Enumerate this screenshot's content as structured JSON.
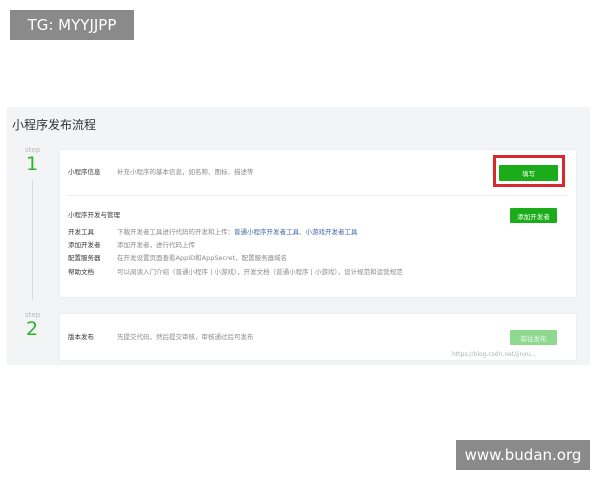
{
  "overlay": {
    "top_left_tag": "TG: MYYJJPP",
    "bottom_right_tag": "www.budan.org",
    "image_watermark": "https://blog.csdn.net/jinxu..."
  },
  "page": {
    "title": "小程序发布流程"
  },
  "steps": [
    {
      "label": "step",
      "number": "1",
      "rows": [
        {
          "label": "小程序信息",
          "desc": "补充小程序的基本信息，如名称、图标、描述等"
        }
      ],
      "fill_button": "填写",
      "section_title": "小程序开发与管理",
      "add_button": "添加开发者",
      "items": [
        {
          "label": "开发工具",
          "desc": "下载开发者工具进行代码的开发和上传：",
          "link1": "普通小程序开发者工具",
          "sep": "、",
          "link2": "小游戏开发者工具"
        },
        {
          "label": "添加开发者",
          "desc": "添加开发者，进行代码上传"
        },
        {
          "label": "配置服务器",
          "desc": "在开发设置页面查看AppID和AppSecret，配置服务器域名"
        },
        {
          "label": "帮助文档",
          "desc": "可以阅读入门介绍（普通小程序 | 小游戏），开发文档（普通小程序 | 小游戏），设计规范和运营规范"
        }
      ]
    },
    {
      "label": "step",
      "number": "2",
      "rows": [
        {
          "label": "版本发布",
          "desc": "先提交代码，然后提交审核，审核通过后可发布"
        }
      ],
      "submit_button": "前往发布"
    }
  ],
  "colors": {
    "accent_green": "#1aad19",
    "disabled_green": "#8fd88f",
    "highlight_red": "#d9282e",
    "link_blue": "#3c65a8"
  }
}
